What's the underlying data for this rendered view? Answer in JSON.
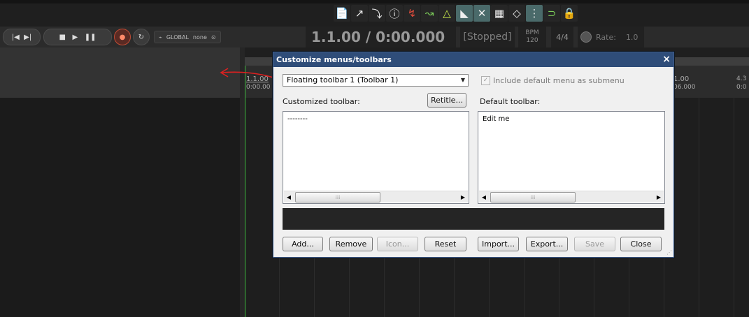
{
  "toolbar": {
    "icons": [
      {
        "name": "new-page-icon",
        "glyph": "📄",
        "style": ""
      },
      {
        "name": "export-icon",
        "glyph": "↗",
        "style": ""
      },
      {
        "name": "render-icon",
        "glyph": "⤵",
        "style": ""
      },
      {
        "name": "info-icon",
        "glyph": "ⓘ",
        "style": ""
      },
      {
        "name": "loop-red-icon",
        "glyph": "↯",
        "style": "red"
      },
      {
        "name": "envelope-green-icon",
        "glyph": "↝",
        "style": "green"
      },
      {
        "name": "metronome-icon",
        "glyph": "△",
        "style": "lime"
      },
      {
        "name": "ripple-icon",
        "glyph": "◣",
        "style": "hl"
      },
      {
        "name": "crossfade-icon",
        "glyph": "✕",
        "style": "hl"
      },
      {
        "name": "grid-icon",
        "glyph": "▦",
        "style": ""
      },
      {
        "name": "envelope-points-icon",
        "glyph": "◇",
        "style": ""
      },
      {
        "name": "snap-grid-icon",
        "glyph": "⋮",
        "style": "hl"
      },
      {
        "name": "magnet-icon",
        "glyph": "⊃",
        "style": "green"
      },
      {
        "name": "lock-icon",
        "glyph": "🔒",
        "style": ""
      }
    ]
  },
  "transport": {
    "global_label": "GLOBAL",
    "global_value": "none",
    "time": "1.1.00 / 0:00.000",
    "status": "[Stopped]",
    "bpm_label": "BPM",
    "bpm_value": "120",
    "time_signature": "4/4",
    "rate_label": "Rate:",
    "rate_value": "1.0"
  },
  "ruler": {
    "left_bar": "1.1.00",
    "left_time": "0:00.00",
    "right_bar": "1.00",
    "right_time": "06.000",
    "edge_bar": "4.3",
    "edge_time": "0:0"
  },
  "dialog": {
    "title": "Customize menus/toolbars",
    "close_glyph": "×",
    "toolbar_select": "Floating toolbar 1 (Toolbar 1)",
    "include_default_label": "Include default menu as submenu",
    "include_default_checked": true,
    "customized_label": "Customized toolbar:",
    "retitle_button": "Retitle...",
    "default_label": "Default toolbar:",
    "customized_items": [
      "--------"
    ],
    "default_items": [
      "Edit me"
    ],
    "buttons": {
      "add": "Add...",
      "remove": "Remove",
      "icon": "Icon...",
      "reset": "Reset",
      "import": "Import...",
      "export": "Export...",
      "save": "Save",
      "close": "Close"
    }
  },
  "colors": {
    "dialog_title_bg": "#2f4d79",
    "play_cursor": "#3fb83f",
    "annotation_arrow": "#e02020"
  }
}
